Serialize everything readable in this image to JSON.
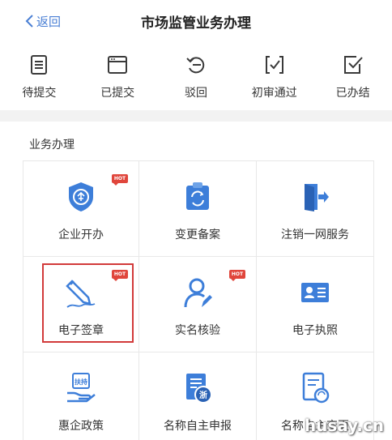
{
  "header": {
    "back_label": "返回",
    "title": "市场监管业务办理"
  },
  "status_tabs": [
    {
      "label": "待提交",
      "icon": "document-list-icon"
    },
    {
      "label": "已提交",
      "icon": "window-icon"
    },
    {
      "label": "驳回",
      "icon": "undo-icon"
    },
    {
      "label": "初审通过",
      "icon": "bracket-check-icon"
    },
    {
      "label": "已办结",
      "icon": "checkbox-icon"
    }
  ],
  "section": {
    "title": "业务办理"
  },
  "services": [
    {
      "label": "企业开办",
      "icon": "enterprise-shield-icon",
      "hot": true
    },
    {
      "label": "变更备案",
      "icon": "change-record-icon",
      "hot": false
    },
    {
      "label": "注销一网服务",
      "icon": "exit-door-icon",
      "hot": false
    },
    {
      "label": "电子签章",
      "icon": "signature-pen-icon",
      "hot": true,
      "selected": true
    },
    {
      "label": "实名核验",
      "icon": "user-verify-icon",
      "hot": true
    },
    {
      "label": "电子执照",
      "icon": "id-card-icon",
      "hot": false
    },
    {
      "label": "惠企政策",
      "icon": "support-hand-icon",
      "hot": false
    },
    {
      "label": "名称自主申报",
      "icon": "name-declare-icon",
      "hot": false
    },
    {
      "label": "名称自主变更",
      "icon": "name-change-icon",
      "hot": false
    }
  ],
  "hot_badge": "HOT",
  "stamp_text": "扶持",
  "seal_text": "浙",
  "colors": {
    "accent": "#4a7fd4",
    "hot": "#e0463c",
    "highlight": "#d23a3a",
    "icon_dark": "#3a3a3a"
  },
  "watermark": "husay.cn"
}
